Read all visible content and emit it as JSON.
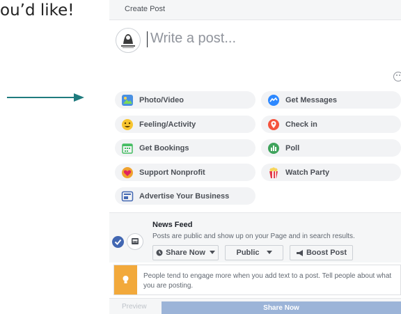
{
  "slide": {
    "text": "ou’d like!"
  },
  "composer": {
    "header": {
      "title": "Create Post"
    },
    "post_input": {
      "placeholder": "Write a post..."
    },
    "actions": [
      {
        "label": "Photo/Video",
        "icon": "photo-video-icon"
      },
      {
        "label": "Get Messages",
        "icon": "messenger-icon"
      },
      {
        "label": "Feeling/Activity",
        "icon": "feeling-emoji-icon"
      },
      {
        "label": "Check in",
        "icon": "location-pin-icon"
      },
      {
        "label": "Get Bookings",
        "icon": "calendar-icon"
      },
      {
        "label": "Poll",
        "icon": "poll-icon"
      },
      {
        "label": "Support Nonprofit",
        "icon": "heart-badge-icon"
      },
      {
        "label": "Watch Party",
        "icon": "popcorn-icon"
      },
      {
        "label": "Advertise Your Business",
        "icon": "advertise-icon"
      }
    ],
    "news_feed": {
      "title": "News Feed",
      "description": "Posts are public and show up on your Page and in search results.",
      "share_now_label": "Share Now",
      "audience_label": "Public",
      "boost_label": "Boost Post"
    },
    "tip": {
      "text": "People tend to engage more when you add text to a post. Tell people about what you are posting."
    },
    "footer": {
      "preview_label": "Preview",
      "share_label": "Share Now"
    }
  },
  "colors": {
    "accent": "#4267b2",
    "arrow": "#1f7b7e",
    "tip": "#f2a93b",
    "share_disabled": "#9cb4d8"
  }
}
